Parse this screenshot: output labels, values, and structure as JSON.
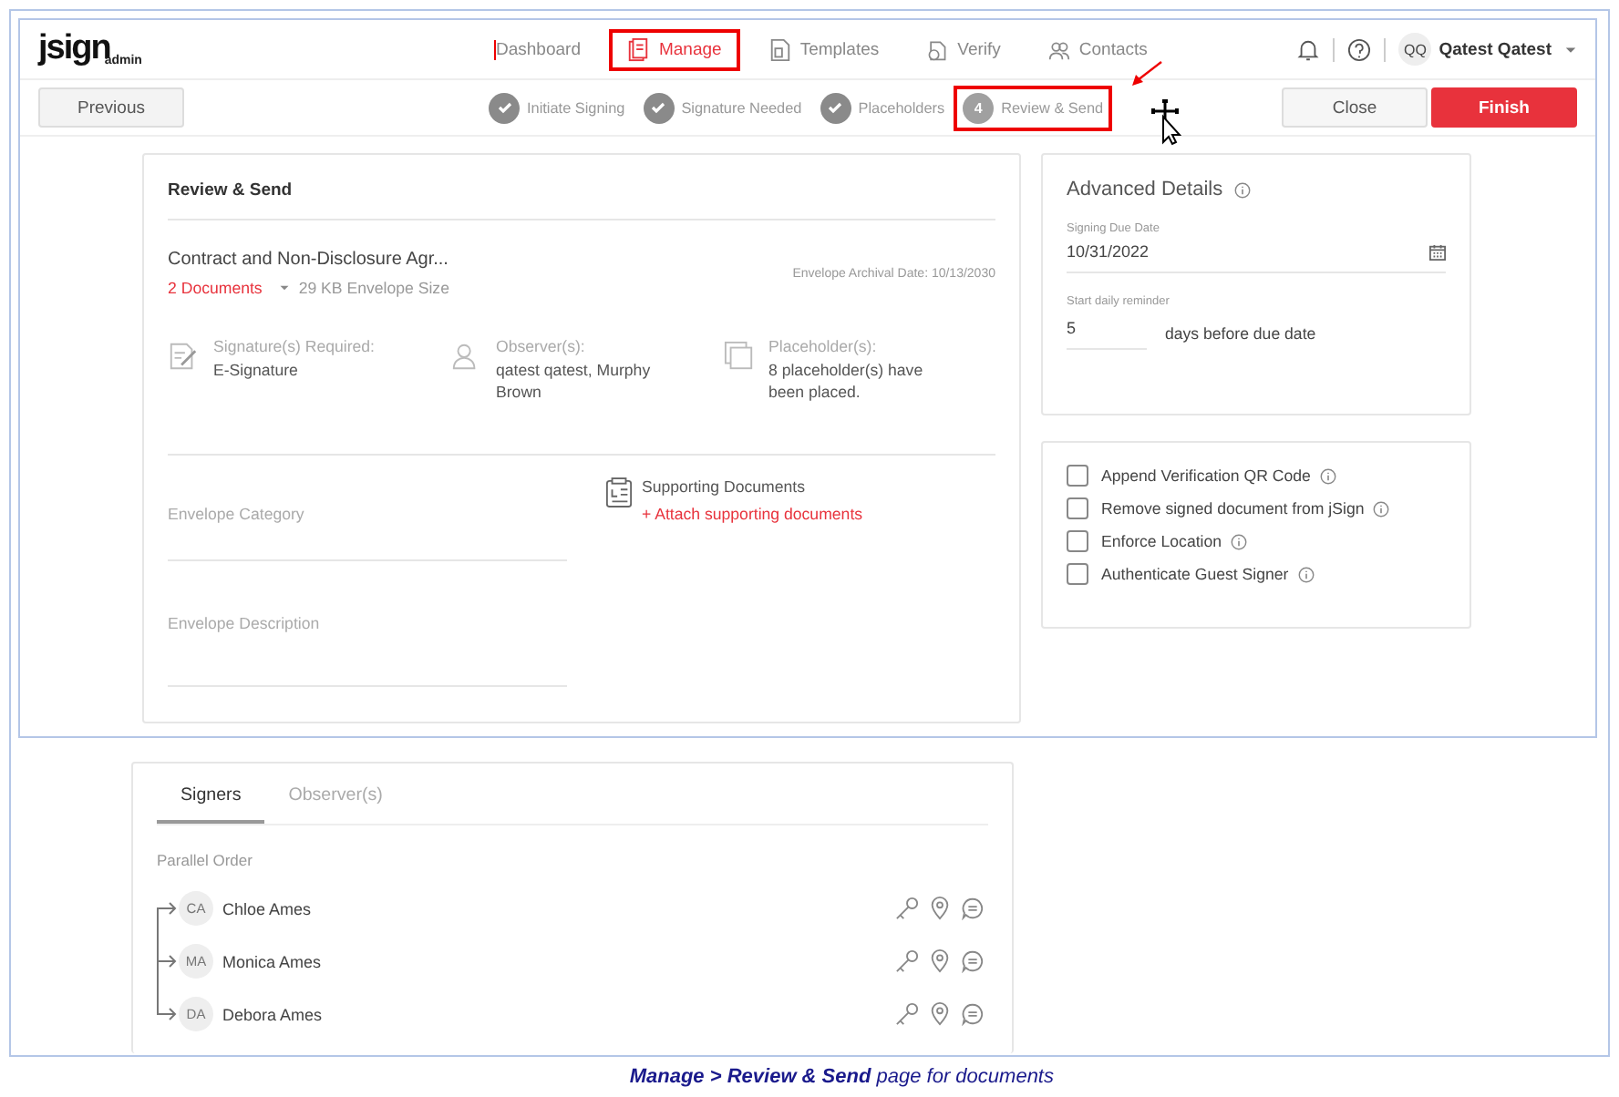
{
  "logo": {
    "text": "jsign",
    "sub": "admin"
  },
  "nav": [
    {
      "label": "Dashboard",
      "selected": false,
      "annotated": false
    },
    {
      "label": "Manage",
      "selected": true,
      "annotated": true
    },
    {
      "label": "Templates",
      "selected": false,
      "annotated": false
    },
    {
      "label": "Verify",
      "selected": false,
      "annotated": false
    },
    {
      "label": "Contacts",
      "selected": false,
      "annotated": false
    }
  ],
  "user": {
    "initials": "QQ",
    "name": "Qatest Qatest"
  },
  "toolbar": {
    "previous": "Previous",
    "close": "Close",
    "finish": "Finish"
  },
  "steps": [
    {
      "label": "Initiate Signing",
      "done": true,
      "annotated": false
    },
    {
      "label": "Signature Needed",
      "done": true,
      "annotated": false
    },
    {
      "label": "Placeholders",
      "done": true,
      "annotated": false
    },
    {
      "number": "4",
      "label": "Review & Send",
      "done": false,
      "annotated": true
    }
  ],
  "review": {
    "title": "Review & Send",
    "envelope_name": "Contract and Non-Disclosure Agr...",
    "archival_date": "Envelope Archival Date: 10/13/2030",
    "documents_link": "2 Documents",
    "envelope_size": "29 KB Envelope Size",
    "summary": [
      {
        "kind": "signature",
        "label": "Signature(s) Required:",
        "value": "E-Signature"
      },
      {
        "kind": "observer",
        "label": "Observer(s):",
        "value": "qatest qatest, Murphy Brown"
      },
      {
        "kind": "placeholder",
        "label": "Placeholder(s):",
        "value": "8 placeholder(s) have been placed."
      }
    ],
    "category_placeholder": "Envelope Category",
    "description_placeholder": "Envelope Description",
    "supporting_title": "Supporting Documents",
    "supporting_link": "+ Attach supporting documents"
  },
  "advanced": {
    "title": "Advanced Details",
    "due_label": "Signing Due Date",
    "due_value": "10/31/2022",
    "reminder_label": "Start daily reminder",
    "reminder_value": "5",
    "reminder_suffix": "days before due date"
  },
  "options": [
    {
      "label": "Append Verification QR Code",
      "checked": false
    },
    {
      "label": "Remove signed document from jSign",
      "checked": false
    },
    {
      "label": "Enforce Location",
      "checked": false
    },
    {
      "label": "Authenticate Guest Signer",
      "checked": false
    }
  ],
  "recipient_tabs": [
    {
      "label": "Signers",
      "selected": true
    },
    {
      "label": "Observer(s)",
      "selected": false
    }
  ],
  "order": "Parallel Order",
  "signers": [
    {
      "initials": "CA",
      "name": "Chloe Ames"
    },
    {
      "initials": "MA",
      "name": "Monica Ames"
    },
    {
      "initials": "DA",
      "name": "Debora Ames"
    }
  ],
  "caption": "**Manage > Review & Send** page for documents"
}
